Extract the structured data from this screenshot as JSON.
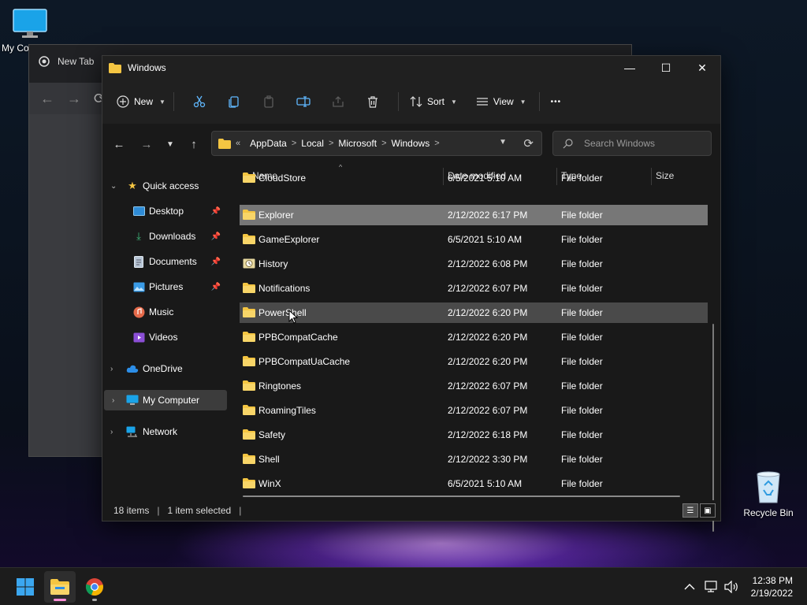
{
  "desktop": {
    "my_computer_label": "My Co",
    "recycle_bin_label": "Recycle Bin"
  },
  "chrome": {
    "tab_title": "New Tab"
  },
  "explorer": {
    "title": "Windows",
    "window_controls": {
      "minimize": "—",
      "maximize": "☐",
      "close": "✕"
    },
    "commands": {
      "new": "New",
      "sort": "Sort",
      "view": "View",
      "more": "•••"
    },
    "address": {
      "overflow": "«",
      "crumbs": [
        "AppData",
        "Local",
        "Microsoft",
        "Windows"
      ]
    },
    "search": {
      "placeholder": "Search Windows"
    },
    "sidebar": {
      "quick_access": "Quick access",
      "desktop": "Desktop",
      "downloads": "Downloads",
      "documents": "Documents",
      "pictures": "Pictures",
      "music": "Music",
      "videos": "Videos",
      "onedrive": "OneDrive",
      "my_computer": "My Computer",
      "network": "Network"
    },
    "columns": {
      "name": "Name",
      "date_modified": "Date modified",
      "type": "Type",
      "size": "Size"
    },
    "rows": [
      {
        "name": "CloudStore",
        "date": "6/5/2021 5:10 AM",
        "type": "File folder"
      },
      {
        "name": "Explorer",
        "date": "2/12/2022 6:17 PM",
        "type": "File folder"
      },
      {
        "name": "GameExplorer",
        "date": "6/5/2021 5:10 AM",
        "type": "File folder"
      },
      {
        "name": "History",
        "date": "2/12/2022 6:08 PM",
        "type": "File folder"
      },
      {
        "name": "Notifications",
        "date": "2/12/2022 6:07 PM",
        "type": "File folder"
      },
      {
        "name": "PowerShell",
        "date": "2/12/2022 6:20 PM",
        "type": "File folder"
      },
      {
        "name": "PPBCompatCache",
        "date": "2/12/2022 6:20 PM",
        "type": "File folder"
      },
      {
        "name": "PPBCompatUaCache",
        "date": "2/12/2022 6:20 PM",
        "type": "File folder"
      },
      {
        "name": "Ringtones",
        "date": "2/12/2022 6:07 PM",
        "type": "File folder"
      },
      {
        "name": "RoamingTiles",
        "date": "2/12/2022 6:07 PM",
        "type": "File folder"
      },
      {
        "name": "Safety",
        "date": "2/12/2022 6:18 PM",
        "type": "File folder"
      },
      {
        "name": "Shell",
        "date": "2/12/2022 3:30 PM",
        "type": "File folder"
      },
      {
        "name": "WinX",
        "date": "6/5/2021 5:10 AM",
        "type": "File folder"
      }
    ],
    "status": {
      "items": "18 items",
      "selected": "1 item selected"
    }
  },
  "taskbar": {
    "time": "12:38 PM",
    "date": "2/19/2022"
  },
  "colors": {
    "accent_blue": "#60b8ff",
    "folder_yellow": "#f4c542",
    "selected_row": "#777777"
  }
}
